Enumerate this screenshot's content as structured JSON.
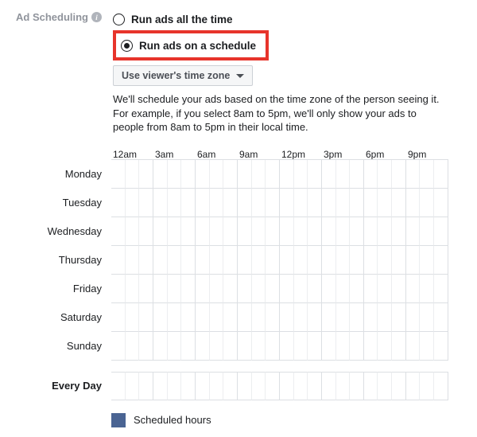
{
  "section_label": "Ad Scheduling",
  "radio": {
    "all_time": "Run ads all the time",
    "schedule": "Run ads on a schedule",
    "selected": "schedule"
  },
  "dropdown_label": "Use viewer's time zone",
  "description_line1": "We'll schedule your ads based on the time zone of the person seeing it.",
  "description_line2": "For example, if you select 8am to 5pm, we'll only show your ads to people from 8am to 5pm in their local time.",
  "hour_headers": [
    "12am",
    "3am",
    "6am",
    "9am",
    "12pm",
    "3pm",
    "6pm",
    "9pm"
  ],
  "days": [
    "Monday",
    "Tuesday",
    "Wednesday",
    "Thursday",
    "Friday",
    "Saturday",
    "Sunday"
  ],
  "every_day_label": "Every Day",
  "legend_label": "Scheduled hours"
}
